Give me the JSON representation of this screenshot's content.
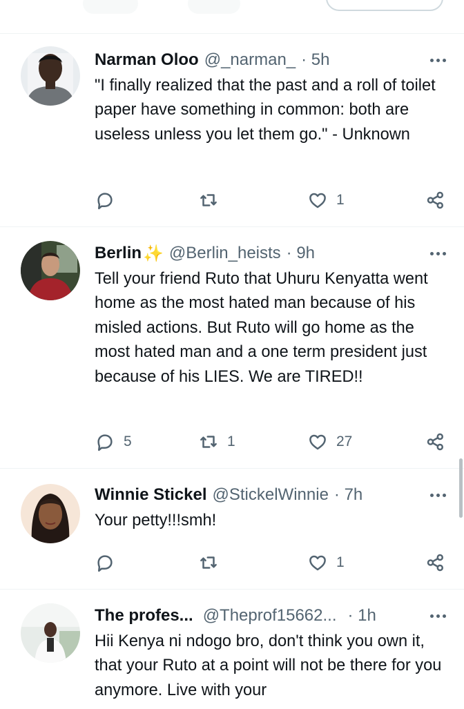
{
  "tweets": [
    {
      "name": "Narman Oloo",
      "badge": "",
      "handle": "@_narman_",
      "time": "· 5h",
      "text": "\"I finally realized that the past and a roll of toilet paper have something in common: both are useless unless you let them go.\" - Unknown",
      "replies": "",
      "retweets": "",
      "likes": "1"
    },
    {
      "name": "Berlin",
      "badge": "✨",
      "handle": "@Berlin_heists",
      "time": "· 9h",
      "text": "Tell your friend Ruto that Uhuru Kenyatta went home as the most hated man because of his misled actions. But Ruto will go home as the most hated man and a one term president just because of his LIES. We are TIRED!!",
      "replies": "5",
      "retweets": "1",
      "likes": "27"
    },
    {
      "name": "Winnie Stickel",
      "badge": "",
      "handle": "@StickelWinnie",
      "time": "· 7h",
      "text": "Your petty!!!smh!",
      "replies": "",
      "retweets": "",
      "likes": "1"
    },
    {
      "name": "The profes...",
      "badge": "",
      "handle": "@Theprof15662...",
      "time": "· 1h",
      "text": "Hii Kenya ni ndogo bro, don't think you own it, that your Ruto at a point will not be there for you anymore. Live with your",
      "replies": "",
      "retweets": "",
      "likes": ""
    }
  ],
  "icons": {
    "reply": "reply-icon",
    "retweet": "retweet-icon",
    "like": "heart-icon",
    "share": "share-icon",
    "more": "more-icon",
    "sparkle": "sparkles-emoji"
  },
  "colors": {
    "text": "#0f1419",
    "secondary": "#536471",
    "divider": "#eff3f4",
    "sparkle": "#f4b400"
  }
}
